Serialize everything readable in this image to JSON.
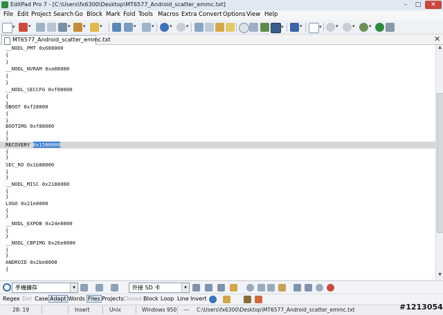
{
  "window": {
    "title": "EditPad Pro 7 - [C:\\Users\\fx6300\\Desktop\\MT6577_Android_scatter_emmc.txt]",
    "controls": {
      "minimize": "–",
      "maximize": "□",
      "close": "✕"
    }
  },
  "menu": [
    "File",
    "Edit",
    "Project",
    "Search",
    "Go",
    "Block",
    "Mark",
    "Fold",
    "Tools",
    "Macros",
    "Extra",
    "Convert",
    "Options",
    "View",
    "Help"
  ],
  "tab": {
    "label": "MT6577_Android_scatter_emmc.txt",
    "close": "✕"
  },
  "editor": {
    "lines": [
      "__NODL_PMT 0x608000",
      "{",
      "}",
      "__NODL_NVRAM 0xa08000",
      "{",
      "}",
      "__NODL_SECCFG 0xf08000",
      "{",
      "}",
      "UBOOT 0xf28000",
      "{",
      "}",
      "BOOTIMG 0xf88000",
      "{",
      "}",
      "RECOVERY 0x1588000",
      "{",
      "}",
      "SEC_RO 0x1b88000",
      "{",
      "}",
      "__NODL_MISC 0x2188000",
      "{",
      "}",
      "LOGO 0x21e8000",
      "{",
      "}",
      "__NODL_EXPDB 0x24e8000",
      "{",
      "}",
      "__NODL_CBPIMG 0x26e8000",
      "{",
      "}",
      "ANDROID 0x2be8000",
      "{"
    ],
    "current_line_prefix": "RECOVERY ",
    "selected_text": "0x1588000"
  },
  "search": {
    "search_value": "手機擴存",
    "replace_value": "外接 SD 卡"
  },
  "options": {
    "regex": "Regex",
    "dot": "Dot",
    "case": "Case",
    "adapt": "Adapt",
    "words": "Words",
    "files": "Files",
    "projects": "Projects",
    "closed": "Closed",
    "block": "Block",
    "loop": "Loop",
    "line": "Line",
    "invert": "Invert"
  },
  "status": {
    "position": "28: 19",
    "mode": "Insert",
    "line_breaks": "Unix",
    "encoding": "Windows 950",
    "extra": "---",
    "path": "C:\\Users\\fx6300\\Desktop\\MT6577_Android_scatter_emmc.txt"
  },
  "watermark": "#1213054",
  "colors": {
    "selection": "#3d7fcf",
    "current_line": "#d7d7d7",
    "close_button": "#c9463d"
  }
}
